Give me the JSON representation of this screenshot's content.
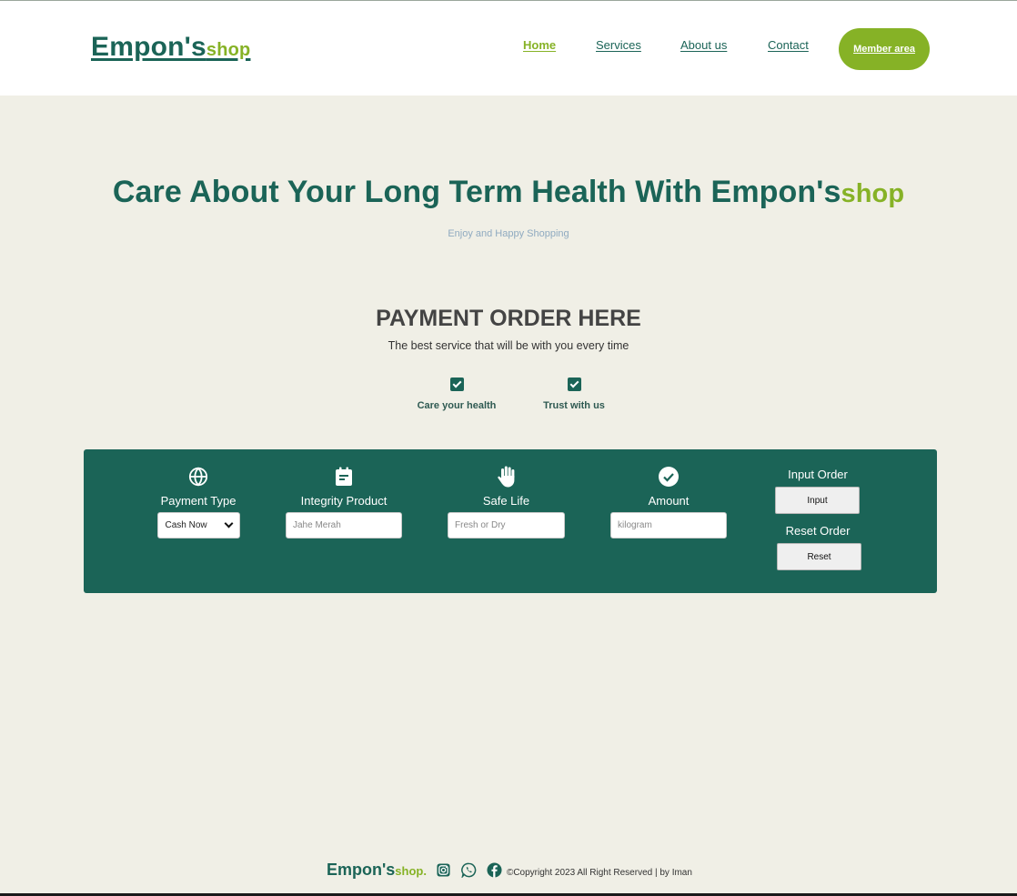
{
  "nav": {
    "brand_main": "Empon's",
    "brand_accent": "shop",
    "links": [
      "Home",
      "Services",
      "About us",
      "Contact"
    ],
    "member_label": "Member area"
  },
  "hero": {
    "title_main": "Care About Your Long Term Health With Empon's",
    "title_accent": "shop",
    "subtitle": "Enjoy and Happy Shopping"
  },
  "payment": {
    "title": "PAYMENT ORDER HERE",
    "subtitle": "The best service that will be with you every time",
    "checks": [
      "Care your health",
      "Trust with us"
    ]
  },
  "form": {
    "payment_type": {
      "label": "Payment Type",
      "value": "Cash Now",
      "icon": "globe-icon"
    },
    "integrity": {
      "label": "Integrity Product",
      "placeholder": "Jahe Merah",
      "icon": "clipboard-icon"
    },
    "safe_life": {
      "label": "Safe Life",
      "placeholder": "Fresh or Dry",
      "icon": "hand-icon"
    },
    "amount": {
      "label": "Amount",
      "placeholder": "kilogram",
      "icon": "check-circle-icon"
    },
    "input_order": {
      "label": "Input Order",
      "button": "Input"
    },
    "reset_order": {
      "label": "Reset Order",
      "button": "Reset"
    }
  },
  "footer": {
    "brand_main": "Empon's",
    "brand_accent": "shop.",
    "copyright": "©Copyright 2023 All Right Reserved | by Iman",
    "icons": [
      "instagram-icon",
      "whatsapp-icon",
      "facebook-icon"
    ]
  },
  "colors": {
    "primary": "#1b6457",
    "accent": "#86b226",
    "background": "#f0efe6"
  }
}
